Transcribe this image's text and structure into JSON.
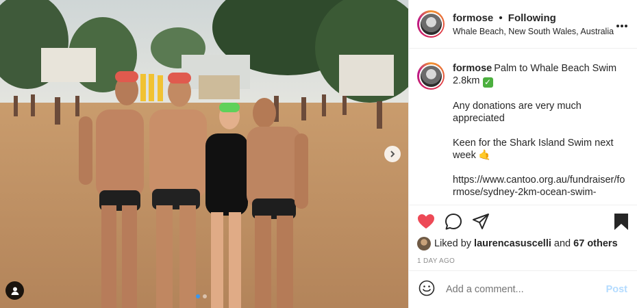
{
  "header": {
    "username": "formose",
    "separator": "•",
    "follow_status": "Following",
    "location": "Whale Beach, New South Wales, Australia",
    "more_icon": "more-horizontal-icon"
  },
  "caption": {
    "username": "formose",
    "line1": "Palm to Whale Beach Swim 2.8km",
    "check_emoji": "✓",
    "para2": "Any donations are very much appreciated",
    "para3": "Keen for the Shark Island Swim next week",
    "para3_emoji": "🤙",
    "url": "https://www.cantoo.org.au/fundraiser/formose/sydney-2km-ocean-swim-"
  },
  "actions": {
    "like_icon": "heart-filled-icon",
    "comment_icon": "comment-icon",
    "share_icon": "share-icon",
    "save_icon": "bookmark-filled-icon",
    "like_color": "#ed4956"
  },
  "likes": {
    "prefix": "Liked by",
    "user": "laurencasuscelli",
    "connector": "and",
    "others": "67 others"
  },
  "timestamp": "1 DAY AGO",
  "comment": {
    "placeholder": "Add a comment...",
    "post_label": "Post"
  },
  "carousel": {
    "slides": 2,
    "active": 1
  }
}
